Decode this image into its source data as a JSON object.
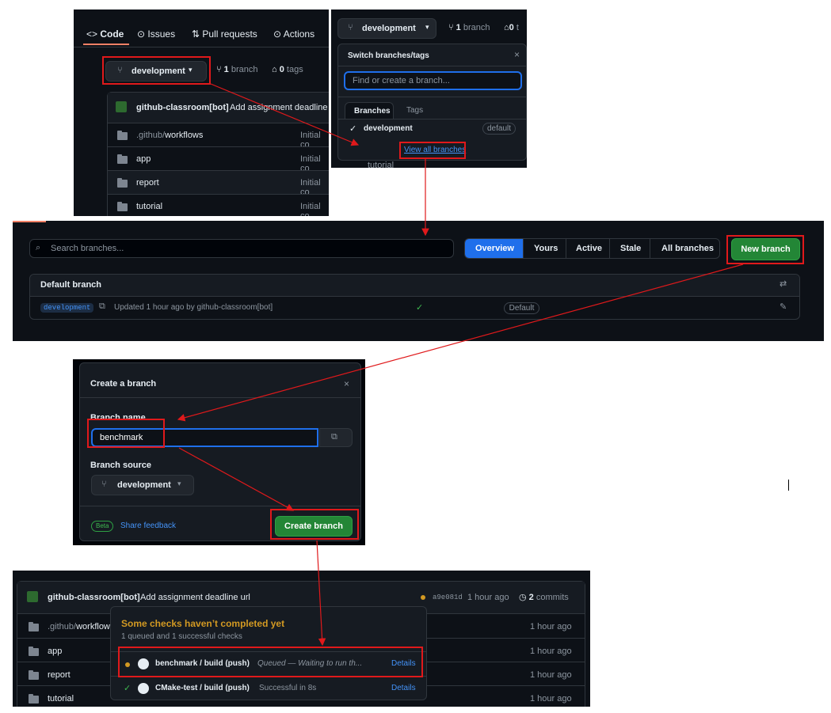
{
  "repo_nav": {
    "tabs": [
      "Code",
      "Issues",
      "Pull requests",
      "Actions"
    ],
    "branch_button": "development",
    "branch_count": "1",
    "branch_word": "branch",
    "tag_count": "0",
    "tag_word": "tags",
    "commit_author": "github-classroom[bot]",
    "commit_message": "Add assignment deadline",
    "files": [
      {
        "prefix": ".github/",
        "name": "workflows",
        "commit": "Initial co"
      },
      {
        "prefix": "",
        "name": "app",
        "commit": "Initial co"
      },
      {
        "prefix": "",
        "name": "report",
        "commit": "Initial co"
      },
      {
        "prefix": "",
        "name": "tutorial",
        "commit": "Initial co"
      }
    ]
  },
  "branch_dropdown": {
    "button": "development",
    "branch_count": "1",
    "branch_word": "branch",
    "tag_count": "0",
    "tag_partial": "t",
    "title": "Switch branches/tags",
    "search_placeholder": "Find or create a branch...",
    "tab_branches": "Branches",
    "tab_tags": "Tags",
    "branch_name": "development",
    "default_label": "default",
    "view_all": "View all branches",
    "behind_row": "tutorial"
  },
  "branches_page": {
    "search_placeholder": "Search branches...",
    "filters": [
      "Overview",
      "Yours",
      "Active",
      "Stale",
      "All branches"
    ],
    "new_branch": "New branch",
    "section_title": "Default branch",
    "branch": "development",
    "updated": "Updated 1 hour ago by github-classroom[bot]",
    "default_badge": "Default"
  },
  "create_dialog": {
    "title": "Create a branch",
    "name_label": "Branch name",
    "name_value": "benchmark",
    "source_label": "Branch source",
    "source_value": "development",
    "beta": "Beta",
    "feedback": "Share feedback",
    "create": "Create branch"
  },
  "result": {
    "commit_author": "github-classroom[bot]",
    "commit_message": "Add assignment deadline url",
    "sha": "a9e081d",
    "time": "1 hour ago",
    "commits_count": "2",
    "commits_word": "commits",
    "files": [
      {
        "prefix": ".github/",
        "name": "workflow",
        "time": "1 hour ago"
      },
      {
        "prefix": "",
        "name": "app",
        "time": "1 hour ago"
      },
      {
        "prefix": "",
        "name": "report",
        "time": "1 hour ago"
      },
      {
        "prefix": "",
        "name": "tutorial",
        "time": "1 hour ago"
      }
    ],
    "popup_title": "Some checks haven’t completed yet",
    "popup_sub": "1 queued and 1 successful checks",
    "checks": [
      {
        "name": "benchmark / build (push)",
        "status": "Queued — Waiting to run th...",
        "details": "Details"
      },
      {
        "name": "CMake-test / build (push)",
        "status": "Successful in 8s",
        "details": "Details"
      }
    ]
  },
  "colors": {
    "accent": "#4493f8",
    "green": "#238636",
    "annotation": "#e0191b",
    "pending": "#d29922"
  }
}
